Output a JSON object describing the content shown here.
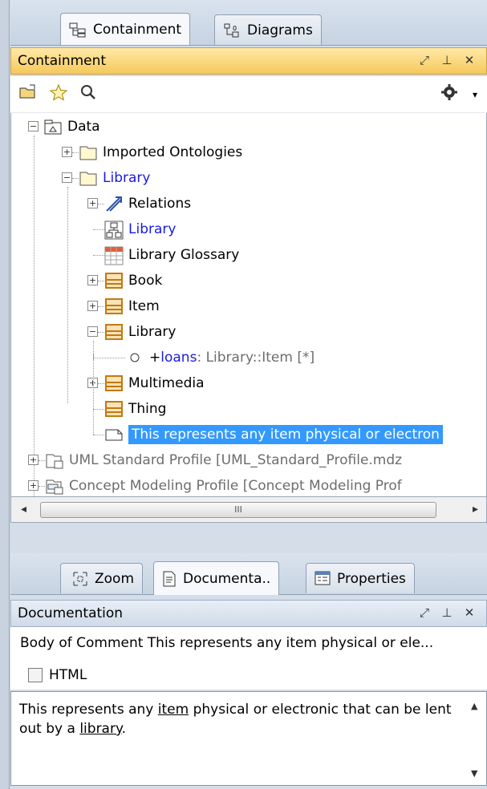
{
  "top_tabs": [
    {
      "label": "Containment",
      "active": true,
      "icon": "containment-tree-icon"
    },
    {
      "label": "Diagrams",
      "active": false,
      "icon": "diagrams-icon"
    }
  ],
  "containment_panel": {
    "title": "Containment",
    "header_icons": [
      "undock-icon",
      "pin-icon",
      "close-icon"
    ]
  },
  "tree": {
    "root": "Data",
    "items": [
      {
        "label": "Imported Ontologies",
        "style": "normal"
      },
      {
        "label": "Library",
        "style": "blue"
      },
      {
        "label": "Relations",
        "style": "normal"
      },
      {
        "label": "Library",
        "style": "blue"
      },
      {
        "label": "Library Glossary",
        "style": "normal"
      },
      {
        "label": "Book",
        "style": "normal"
      },
      {
        "label": "Item",
        "style": "normal"
      },
      {
        "label": "Library",
        "style": "normal"
      },
      {
        "label_prefix": "+",
        "label_name": "loans",
        "label_type": " : Library::Item [*]"
      },
      {
        "label": "Multimedia",
        "style": "normal"
      },
      {
        "label": "Thing",
        "style": "normal"
      },
      {
        "label": "This represents any item physical or electron",
        "style": "selected"
      },
      {
        "label": "UML Standard Profile [UML_Standard_Profile.mdz",
        "style": "gray"
      },
      {
        "label": "Concept Modeling Profile [Concept Modeling Prof",
        "style": "gray"
      }
    ]
  },
  "hscroll": {
    "thumb_grip": "III"
  },
  "bottom_tabs": [
    {
      "label": "Zoom",
      "active": false
    },
    {
      "label": "Documenta..",
      "active": true
    },
    {
      "label": "Properties",
      "active": false
    }
  ],
  "documentation_panel": {
    "title": "Documentation",
    "comment_line": "Body of Comment This represents any item physical or ele...",
    "html_checkbox_label": "HTML",
    "text_parts": [
      "This represents any ",
      "item",
      " physical or electronic that can be lent out by a ",
      "library",
      "."
    ]
  }
}
